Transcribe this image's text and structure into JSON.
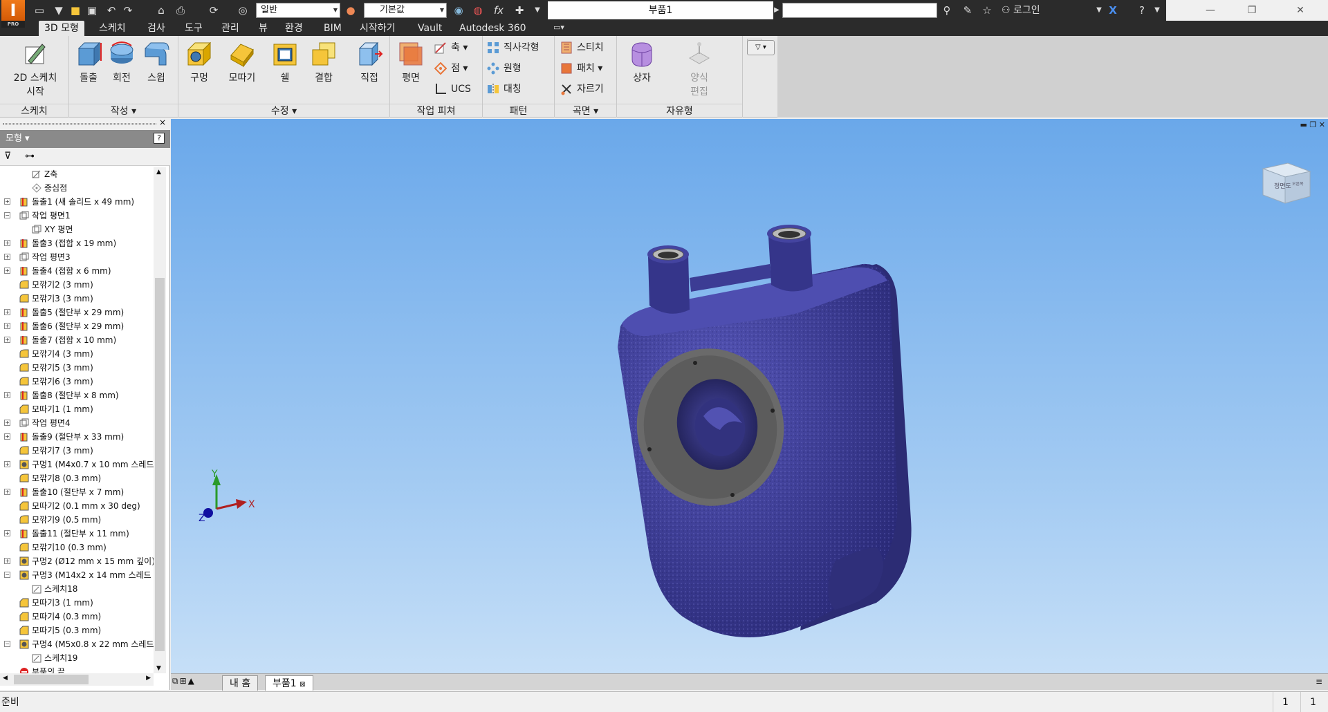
{
  "titlebar": {
    "logo_text": "I",
    "logo_badge": "PRO",
    "style_dropdown": "일반",
    "material_dropdown": "기본값",
    "document_title": "부품1",
    "login_label": "로그인",
    "fx_label": "fx"
  },
  "tabs": [
    {
      "label": "3D 모형"
    },
    {
      "label": "스케치"
    },
    {
      "label": "검사"
    },
    {
      "label": "도구"
    },
    {
      "label": "관리"
    },
    {
      "label": "뷰"
    },
    {
      "label": "환경"
    },
    {
      "label": "BIM"
    },
    {
      "label": "시작하기"
    },
    {
      "label": "Vault"
    },
    {
      "label": "Autodesk 360"
    }
  ],
  "ribbon": {
    "sketch_panel": {
      "title": "스케치",
      "start_2d_line1": "2D 스케치",
      "start_2d_line2": "시작"
    },
    "create_panel": {
      "title": "작성",
      "extrude": "돌출",
      "revolve": "회전",
      "sweep": "스윕"
    },
    "modify_panel": {
      "title": "수정",
      "hole": "구멍",
      "fillet": "모따기",
      "shell": "쉘",
      "combine": "결합",
      "direct": "직접"
    },
    "work_features_panel": {
      "title": "작업 피쳐",
      "plane": "평면",
      "axis": "축",
      "point": "점",
      "ucs": "UCS"
    },
    "pattern_panel": {
      "title": "패턴",
      "rectangular": "직사각형",
      "circular": "원형",
      "mirror": "대칭"
    },
    "surface_panel": {
      "title": "곡면",
      "stitch": "스티치",
      "patch": "패치",
      "trim": "자르기"
    },
    "freeform_panel": {
      "title": "자유형",
      "box": "상자",
      "edit_form_line1": "양식",
      "edit_form_line2": "편집"
    }
  },
  "browser": {
    "header": "모형",
    "tree": [
      {
        "label": "Z축",
        "indent": 2,
        "icon": "axis"
      },
      {
        "label": "중심점",
        "indent": 2,
        "icon": "point"
      },
      {
        "label": "돌출1 (새 솔리드 x 49 mm)",
        "indent": 1,
        "icon": "extrude",
        "expandable": true
      },
      {
        "label": "작업 평면1",
        "indent": 1,
        "icon": "plane",
        "expandable": true,
        "expanded": true
      },
      {
        "label": "XY 평면",
        "indent": 2,
        "icon": "plane"
      },
      {
        "label": "돌출3 (접합 x 19 mm)",
        "indent": 1,
        "icon": "extrude",
        "expandable": true
      },
      {
        "label": "작업 평면3",
        "indent": 1,
        "icon": "plane",
        "expandable": true
      },
      {
        "label": "돌출4 (접합 x 6 mm)",
        "indent": 1,
        "icon": "extrude",
        "expandable": true
      },
      {
        "label": "모깎기2 (3 mm)",
        "indent": 1,
        "icon": "fillet"
      },
      {
        "label": "모깎기3 (3 mm)",
        "indent": 1,
        "icon": "fillet"
      },
      {
        "label": "돌출5 (절단부 x 29 mm)",
        "indent": 1,
        "icon": "extrude",
        "expandable": true
      },
      {
        "label": "돌출6 (절단부 x 29 mm)",
        "indent": 1,
        "icon": "extrude",
        "expandable": true
      },
      {
        "label": "돌출7 (접합 x 10 mm)",
        "indent": 1,
        "icon": "extrude",
        "expandable": true
      },
      {
        "label": "모깎기4 (3 mm)",
        "indent": 1,
        "icon": "fillet"
      },
      {
        "label": "모깎기5 (3 mm)",
        "indent": 1,
        "icon": "fillet"
      },
      {
        "label": "모깎기6 (3 mm)",
        "indent": 1,
        "icon": "fillet"
      },
      {
        "label": "돌출8 (절단부 x 8 mm)",
        "indent": 1,
        "icon": "extrude",
        "expandable": true
      },
      {
        "label": "모따기1 (1 mm)",
        "indent": 1,
        "icon": "chamfer"
      },
      {
        "label": "작업 평면4",
        "indent": 1,
        "icon": "plane",
        "expandable": true
      },
      {
        "label": "돌출9 (절단부 x 33 mm)",
        "indent": 1,
        "icon": "extrude",
        "expandable": true
      },
      {
        "label": "모깎기7 (3 mm)",
        "indent": 1,
        "icon": "fillet"
      },
      {
        "label": "구멍1 (M4x0.7 x 10 mm 스레드",
        "indent": 1,
        "icon": "hole",
        "expandable": true
      },
      {
        "label": "모깎기8 (0.3 mm)",
        "indent": 1,
        "icon": "fillet"
      },
      {
        "label": "돌출10 (절단부 x 7 mm)",
        "indent": 1,
        "icon": "extrude",
        "expandable": true
      },
      {
        "label": "모따기2 (0.1 mm x 30 deg)",
        "indent": 1,
        "icon": "chamfer"
      },
      {
        "label": "모깎기9 (0.5 mm)",
        "indent": 1,
        "icon": "fillet"
      },
      {
        "label": "돌출11 (절단부 x 11 mm)",
        "indent": 1,
        "icon": "extrude",
        "expandable": true
      },
      {
        "label": "모깎기10 (0.3 mm)",
        "indent": 1,
        "icon": "fillet"
      },
      {
        "label": "구멍2 (Ø12 mm x 15 mm 깊이)",
        "indent": 1,
        "icon": "hole",
        "expandable": true
      },
      {
        "label": "구멍3 (M14x2 x 14 mm 스레드 ;",
        "indent": 1,
        "icon": "hole",
        "expandable": true,
        "expanded": true
      },
      {
        "label": "스케치18",
        "indent": 2,
        "icon": "sketch"
      },
      {
        "label": "모따기3 (1 mm)",
        "indent": 1,
        "icon": "chamfer"
      },
      {
        "label": "모따기4 (0.3 mm)",
        "indent": 1,
        "icon": "chamfer"
      },
      {
        "label": "모따기5 (0.3 mm)",
        "indent": 1,
        "icon": "chamfer"
      },
      {
        "label": "구멍4 (M5x0.8 x 22 mm 스레드",
        "indent": 1,
        "icon": "hole",
        "expandable": true,
        "expanded": true
      },
      {
        "label": "스케치19",
        "indent": 2,
        "icon": "sketch"
      },
      {
        "label": "부품의 끝",
        "indent": 1,
        "icon": "end"
      }
    ]
  },
  "viewcube": {
    "front_label": "정면도",
    "right_label": "오른쪽"
  },
  "triad": {
    "x_label": "X",
    "y_label": "Y",
    "z_label": "Z"
  },
  "doc_tabs": [
    {
      "label": "내 홈"
    },
    {
      "label": "부품1"
    }
  ],
  "status": {
    "text": "준비",
    "count1": "1",
    "count2": "1"
  },
  "colors": {
    "model_body": "#3f3f9c",
    "viewport_top": "#6aa8ea",
    "viewport_bottom": "#c6dff7",
    "accent": "#f07a1a"
  }
}
